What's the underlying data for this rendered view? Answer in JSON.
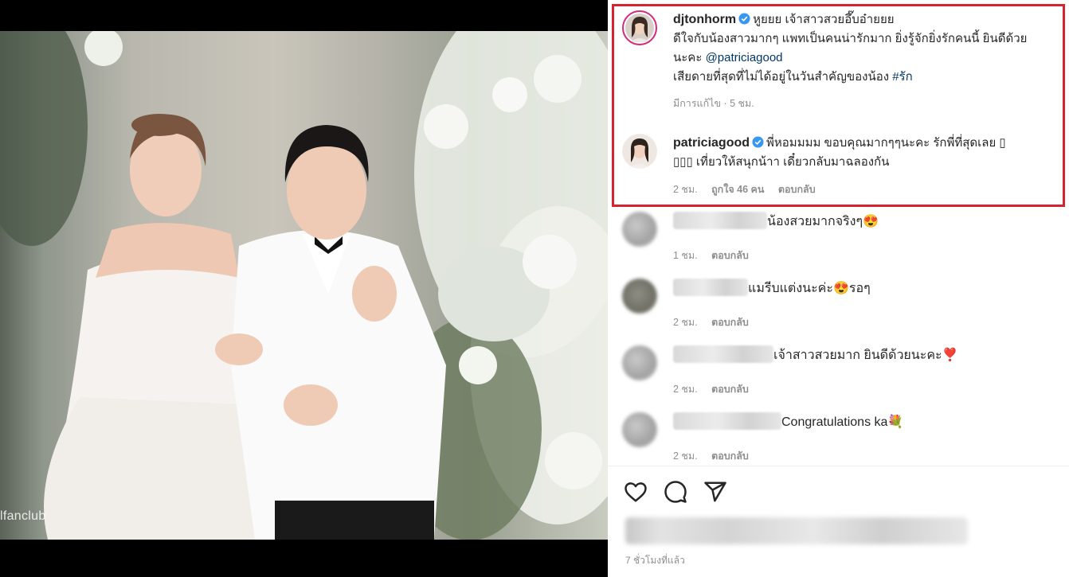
{
  "photo": {
    "watermark": "lfanclub"
  },
  "highlighted_comments": [
    {
      "username": "djtonhorm",
      "verified": true,
      "text_line1": "หูยยย เจ้าสาวสวยอึ๊บอ๋ายยย",
      "text_line2": "ดีใจกับน้องสาวมากๆ แพทเป็นคนน่ารักมาก ยิ่งรู้จักยิ่งรักคนนี้ ยินดีด้วย",
      "text_line3_prefix": "นะคะ ",
      "mention": "@patriciagood",
      "text_line4_prefix": "เสียดายที่สุดที่ไม่ได้อยู่ในวันสำคัญของน้อง ",
      "hashtag": "#รัก",
      "meta": "มีการแก้ไข · 5 ชม."
    },
    {
      "username": "patriciagood",
      "verified": true,
      "text_line1": "พี่หอมมมม ขอบคุณมากๆๆนะคะ รักพี่ที่สุดเลย ▯",
      "text_line2": "▯▯▯ เที่ยวให้สนุกน้าา เดี๋ยวกลับมาฉลองกัน",
      "meta_time": "2 ชม.",
      "meta_likes": "ถูกใจ 46 คน",
      "meta_reply": "ตอบกลับ"
    }
  ],
  "comments": [
    {
      "text": "น้องสวยมากจริงๆ😍",
      "time": "1 ชม.",
      "reply": "ตอบกลับ"
    },
    {
      "text": "แมรีบแต่งนะค่ะ😍รอๆ",
      "time": "2 ชม.",
      "reply": "ตอบกลับ"
    },
    {
      "text": "เจ้าสาวสวยมาก ยินดีด้วยนะคะ❣️",
      "time": "2 ชม.",
      "reply": "ตอบกลับ"
    },
    {
      "text": "Congratulations ka💐",
      "time": "2 ชม.",
      "reply": "ตอบกลับ"
    }
  ],
  "actions": {
    "like_icon": "heart-icon",
    "comment_icon": "comment-icon",
    "share_icon": "share-icon"
  },
  "post_time": "7 ชั่วโมงที่แล้ว",
  "colors": {
    "highlight_border": "#d6232f",
    "link": "#00376b",
    "verified": "#3897f0",
    "meta": "#8e8e8e"
  }
}
